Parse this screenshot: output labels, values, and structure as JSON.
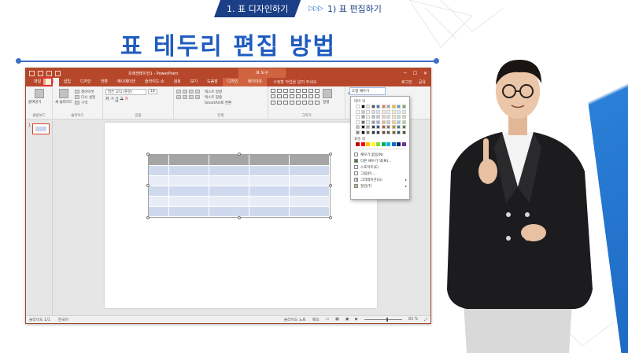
{
  "breadcrumb": {
    "active": "1. 표 디자인하기",
    "arrows": "▷▷▷",
    "next": "1) 표 편집하기"
  },
  "slide_title": "표 테두리 편집 방법",
  "colors": {
    "brand_blue": "#1f5cc0",
    "ppt_orange": "#b7472a",
    "highlight_red": "#e53030"
  },
  "ppt": {
    "window_title": "프레젠테이션1 - PowerPoint",
    "context_tab_group": "표 도구",
    "tabs": [
      "파일",
      "홈",
      "삽입",
      "디자인",
      "전환",
      "애니메이션",
      "슬라이드 쇼",
      "검토",
      "보기",
      "도움말",
      "디자인",
      "레이아웃"
    ],
    "active_tab_index": 1,
    "tell_me": "수행할 작업을 알려 주세요",
    "account": "로그인",
    "share": "공유",
    "ribbon_groups": {
      "clipboard": {
        "label": "클립보드",
        "paste": "붙여넣기"
      },
      "slides": {
        "label": "슬라이드",
        "new_slide": "새 슬라이드",
        "layout": "레이아웃",
        "reset": "다시 설정",
        "section": "구역"
      },
      "font": {
        "label": "글꼴",
        "font_name": "맑은 고딕 (본문)",
        "font_size": "18"
      },
      "paragraph": {
        "label": "단락",
        "text_direction": "텍스트 방향",
        "align_text": "텍스트 맞춤",
        "smartart": "SmartArt로 변환"
      },
      "drawing": {
        "label": "그리기",
        "arrange": "정렬",
        "quick_styles": "빠른 스타일"
      },
      "editing": {
        "find": "찾기"
      }
    },
    "shape_fill_button": "도형 채우기",
    "dropdown": {
      "theme_colors_label": "테마 색",
      "standard_colors_label": "표준 색",
      "items": [
        {
          "label": "채우기 없음(N)",
          "icon": "none-icon",
          "has_submenu": false
        },
        {
          "label": "다른 채우기 색(M)...",
          "icon": "palette-icon",
          "has_submenu": false
        },
        {
          "label": "스포이트(E)",
          "icon": "eyedropper-icon",
          "has_submenu": false
        },
        {
          "label": "그림(P)...",
          "icon": "picture-icon",
          "has_submenu": false
        },
        {
          "label": "그라데이션(G)",
          "icon": "gradient-icon",
          "has_submenu": true
        },
        {
          "label": "질감(T)",
          "icon": "texture-icon",
          "has_submenu": true
        }
      ],
      "theme_colors": [
        "#ffffff",
        "#000000",
        "#e7e6e6",
        "#44546a",
        "#4472c4",
        "#ed7d31",
        "#a5a5a5",
        "#ffc000",
        "#5b9bd5",
        "#70ad47"
      ],
      "standard_colors": [
        "#c00000",
        "#ff0000",
        "#ffc000",
        "#ffff00",
        "#92d050",
        "#00b050",
        "#00b0f0",
        "#0070c0",
        "#002060",
        "#7030a0"
      ]
    },
    "slide_number": "1",
    "status": {
      "slide_count": "슬라이드 1/1",
      "language": "한국어",
      "notes": "슬라이드 노트",
      "comments": "메모",
      "zoom": "83 %"
    }
  }
}
